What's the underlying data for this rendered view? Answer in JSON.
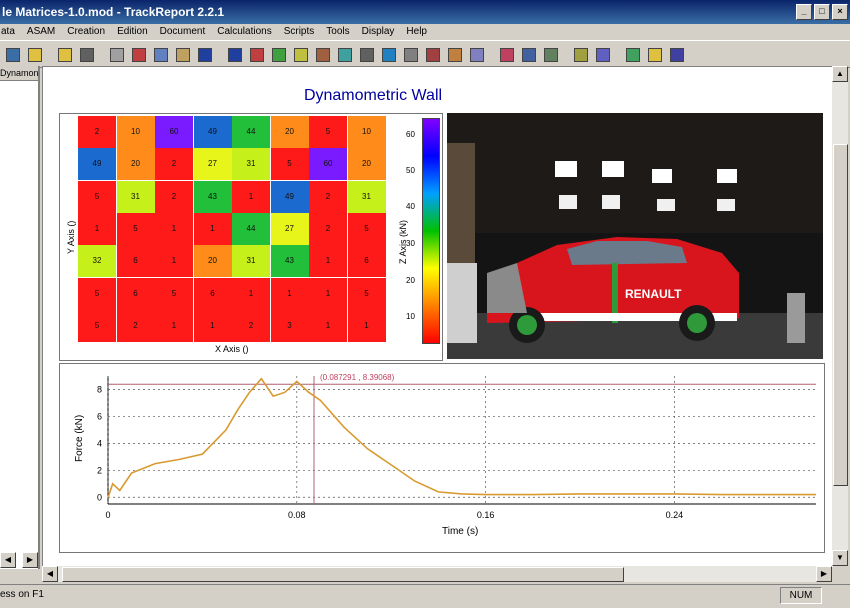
{
  "window": {
    "title": "le Matrices-1.0.mod - TrackReport 2.2.1",
    "controls": [
      "_",
      "□",
      "×"
    ]
  },
  "menu": [
    "ata",
    "ASAM",
    "Creation",
    "Edition",
    "Document",
    "Calculations",
    "Scripts",
    "Tools",
    "Display",
    "Help"
  ],
  "toolbar": {
    "buttons": [
      "save",
      "open-folder",
      "open-folder-2",
      "print",
      "print-preview",
      "cut",
      "copy",
      "paste",
      "undo",
      "redo",
      "tool-1",
      "tool-2",
      "tool-3",
      "tool-4",
      "tool-5",
      "tool-6",
      "tool-7",
      "tool-8",
      "tool-9",
      "tool-10",
      "tool-11",
      "tool-12",
      "tool-13",
      "tool-14",
      "tool-15",
      "tool-16",
      "tool-17",
      "help",
      "context-help"
    ]
  },
  "sidebar": {
    "tab_label": "Dynamon"
  },
  "document": {
    "heading": "Dynamometric Wall"
  },
  "heatmap": {
    "x_label": "X Axis ()",
    "y_label": "Y Axis ()",
    "z_label": "Z Axis (kN)",
    "colorbar_ticks": [
      "60",
      "50",
      "40",
      "30",
      "20",
      "10"
    ],
    "grid": [
      [
        "2",
        "10",
        "60",
        "49",
        "44",
        "20",
        "5",
        "10"
      ],
      [
        "49",
        "20",
        "2",
        "27",
        "31",
        "5",
        "60",
        "20"
      ],
      [
        "5",
        "31",
        "2",
        "43",
        "1",
        "49",
        "2",
        "31"
      ],
      [
        "1",
        "5",
        "1",
        "1",
        "44",
        "27",
        "2",
        "5"
      ],
      [
        "32",
        "6",
        "1",
        "20",
        "31",
        "43",
        "1",
        "6"
      ],
      [
        "5",
        "6",
        "5",
        "6",
        "1",
        "1",
        "1",
        "5"
      ],
      [
        "5",
        "2",
        "1",
        "1",
        "2",
        "3",
        "1",
        "1"
      ]
    ],
    "colors": {
      "red": "#ff1a1a",
      "orange": "#ff8c1a",
      "purple": "#7a1aff",
      "blue": "#1a6ad0",
      "green": "#22c03a",
      "yellow": "#e8f51a",
      "yellowgreen": "#c6f01a"
    }
  },
  "photo": {
    "brand_text": "RENAULT"
  },
  "chart_data": {
    "type": "line",
    "xlabel": "Time (s)",
    "ylabel": "Force (kN)",
    "x_ticks": [
      "0",
      "0.08",
      "0.16",
      "0.24"
    ],
    "y_ticks": [
      "0",
      "2",
      "4",
      "6",
      "8"
    ],
    "xlim": [
      0,
      0.3
    ],
    "ylim": [
      -0.5,
      9
    ],
    "cursor": {
      "x": 0.087291,
      "label": "(0.087291 , 8.39068)"
    },
    "reference_line": 8.39,
    "color": "#d89a30",
    "series": [
      {
        "x": [
          0,
          0.002,
          0.005,
          0.01,
          0.02,
          0.03,
          0.04,
          0.05,
          0.055,
          0.06,
          0.065,
          0.07,
          0.075,
          0.08,
          0.085,
          0.09,
          0.1,
          0.11,
          0.12,
          0.13,
          0.14,
          0.15,
          0.16,
          0.18,
          0.2,
          0.22,
          0.24,
          0.26,
          0.28,
          0.3
        ],
        "y": [
          0,
          1.0,
          0.5,
          1.8,
          2.5,
          2.8,
          3.2,
          5.0,
          6.5,
          7.8,
          8.8,
          7.5,
          7.8,
          8.6,
          7.8,
          7.2,
          5.2,
          3.6,
          2.4,
          1.2,
          0.4,
          0.25,
          0.2,
          0.2,
          0.25,
          0.25,
          0.25,
          0.2,
          0.2,
          0.2
        ]
      }
    ]
  },
  "status": {
    "help_text": "ess on F1",
    "num_indicator": "NUM"
  }
}
